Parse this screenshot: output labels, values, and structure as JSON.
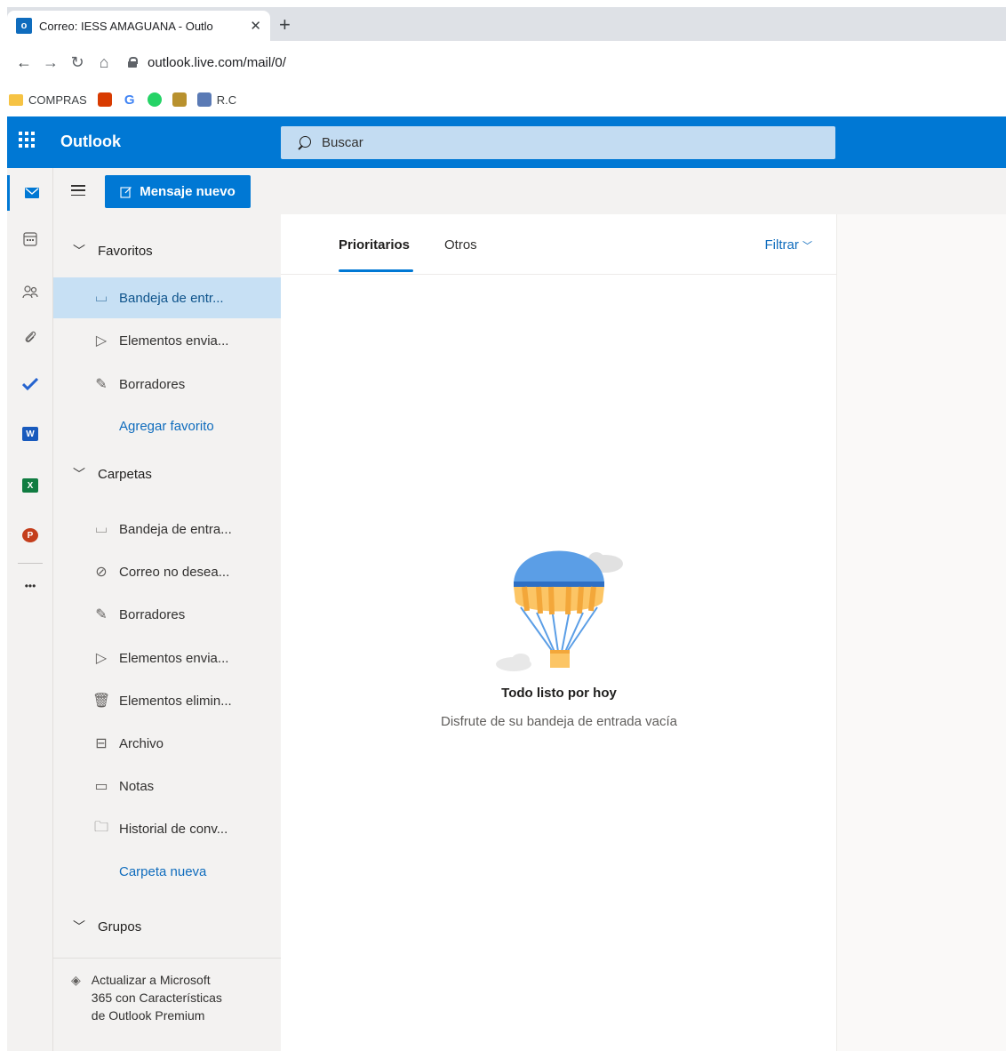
{
  "browser": {
    "tab_title": "Correo: IESS AMAGUANA - Outlo",
    "tab_close": "✕",
    "new_tab": "+",
    "url": "outlook.live.com/mail/0/",
    "bookmarks": [
      {
        "label": "COMPRAS",
        "icon": "folder-icon"
      },
      {
        "label": "",
        "icon": "office-icon",
        "color": "#d83b01"
      },
      {
        "label": "",
        "icon": "google-icon",
        "color": "#4285f4"
      },
      {
        "label": "",
        "icon": "whatsapp-icon",
        "color": "#25d366"
      },
      {
        "label": "",
        "icon": "crest-icon",
        "color": "#7a5c1e"
      },
      {
        "label": "R.C",
        "icon": "registro-civil-icon"
      }
    ]
  },
  "header": {
    "brand": "Outlook",
    "search_placeholder": "Buscar",
    "accent": "#0078d4"
  },
  "command": {
    "new_message": "Mensaje nuevo"
  },
  "rail": [
    "mail-icon",
    "calendar-icon",
    "people-icon",
    "attachment-icon",
    "todo-icon",
    "word-icon",
    "excel-icon",
    "powerpoint-icon",
    "more-apps-icon"
  ],
  "rail_apps": {
    "word": "W",
    "excel": "X",
    "powerpoint": "P",
    "more": "•••"
  },
  "folders": {
    "favorites_header": "Favoritos",
    "favorites": [
      {
        "label": "Bandeja de entr...",
        "icon": "inbox-icon",
        "selected": true
      },
      {
        "label": "Elementos envia...",
        "icon": "send-icon"
      },
      {
        "label": "Borradores",
        "icon": "pencil-icon"
      }
    ],
    "add_favorite": "Agregar favorito",
    "folders_header": "Carpetas",
    "folders": [
      {
        "label": "Bandeja de entra...",
        "icon": "inbox-icon"
      },
      {
        "label": "Correo no desea...",
        "icon": "blocked-icon"
      },
      {
        "label": "Borradores",
        "icon": "pencil-icon"
      },
      {
        "label": "Elementos envia...",
        "icon": "send-icon"
      },
      {
        "label": "Elementos elimin...",
        "icon": "trash-icon"
      },
      {
        "label": "Archivo",
        "icon": "archive-icon"
      },
      {
        "label": "Notas",
        "icon": "note-icon"
      },
      {
        "label": "Historial de conv...",
        "icon": "folder-icon"
      }
    ],
    "new_folder": "Carpeta nueva",
    "groups_header": "Grupos",
    "upgrade": "Actualizar a Microsoft 365 con Características de Outlook Premium"
  },
  "list": {
    "tabs": [
      "Prioritarios",
      "Otros"
    ],
    "active_tab": "Prioritarios",
    "filter": "Filtrar",
    "empty_title": "Todo listo por hoy",
    "empty_subtitle": "Disfrute de su bandeja de entrada vacía"
  }
}
